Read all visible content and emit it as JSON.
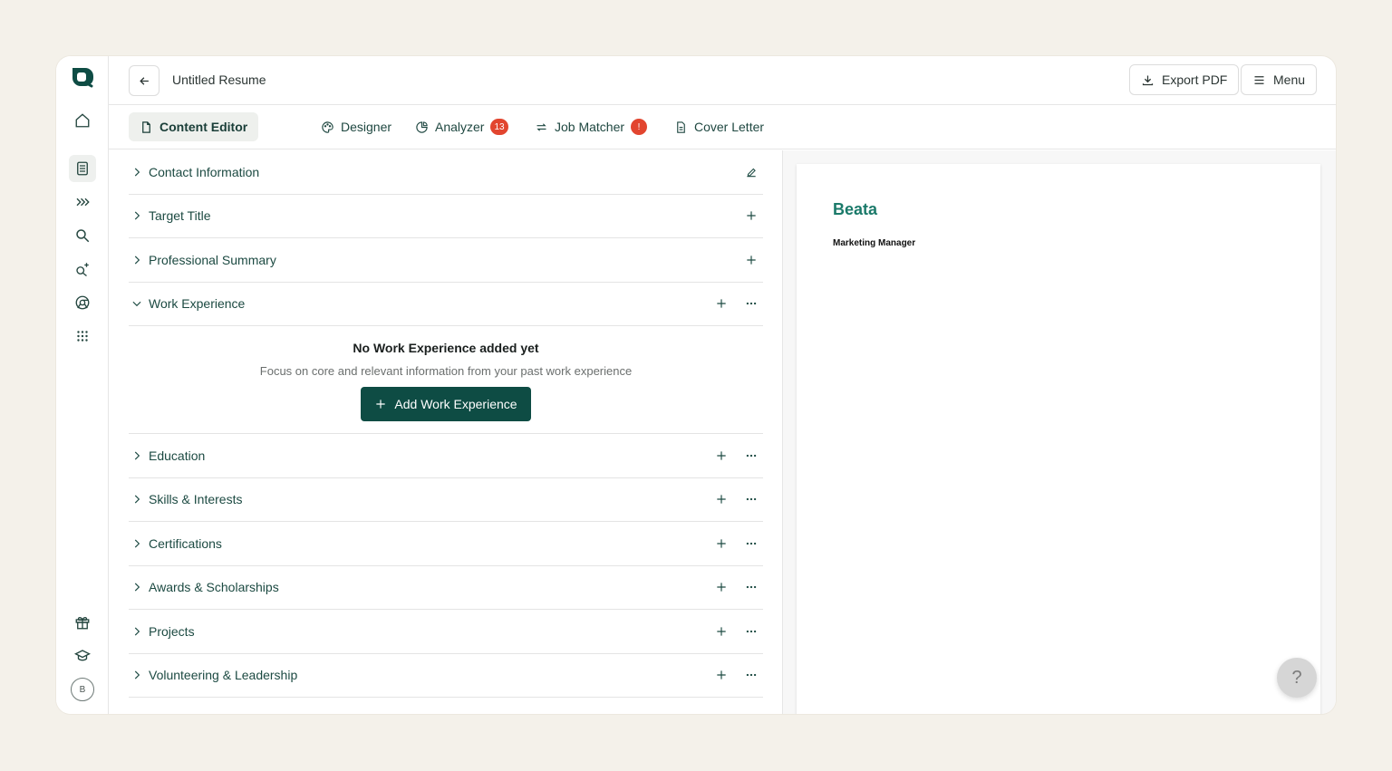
{
  "header": {
    "doc_title": "Untitled Resume",
    "export_label": "Export PDF",
    "menu_label": "Menu"
  },
  "tabs": [
    {
      "label": "Content Editor",
      "icon": "file-icon",
      "active": true
    },
    {
      "label": "Designer",
      "icon": "palette-icon"
    },
    {
      "label": "Analyzer",
      "icon": "pie-chart-icon",
      "badge": "13"
    },
    {
      "label": "Job Matcher",
      "icon": "arrows-icon",
      "badge": "!"
    },
    {
      "label": "Cover Letter",
      "icon": "document-icon"
    }
  ],
  "sidebar": {
    "avatar_initial": "B",
    "icons": [
      "home-icon",
      "resume-icon",
      "chevrons-icon",
      "search-icon",
      "ai-search-icon",
      "chrome-icon",
      "apps-grid-icon",
      "gift-icon",
      "graduation-cap-icon"
    ]
  },
  "sections": [
    {
      "label": "Contact Information",
      "action": "edit"
    },
    {
      "label": "Target Title",
      "action": "add"
    },
    {
      "label": "Professional Summary",
      "action": "add"
    },
    {
      "label": "Work Experience",
      "action": "add-more",
      "expanded": true
    },
    {
      "label": "Education",
      "action": "add-more"
    },
    {
      "label": "Skills & Interests",
      "action": "add-more"
    },
    {
      "label": "Certifications",
      "action": "add-more"
    },
    {
      "label": "Awards & Scholarships",
      "action": "add-more"
    },
    {
      "label": "Projects",
      "action": "add-more"
    },
    {
      "label": "Volunteering & Leadership",
      "action": "add-more"
    }
  ],
  "work_empty": {
    "title": "No Work Experience added yet",
    "subtitle": "Focus on core and relevant information from your past work experience",
    "button": "Add Work Experience"
  },
  "preview": {
    "name": "Beata",
    "title": "Marketing Manager"
  },
  "help_label": "?",
  "colors": {
    "accent": "#0e4c44",
    "badge": "#e2452f",
    "preview_name": "#1b7a6a"
  }
}
